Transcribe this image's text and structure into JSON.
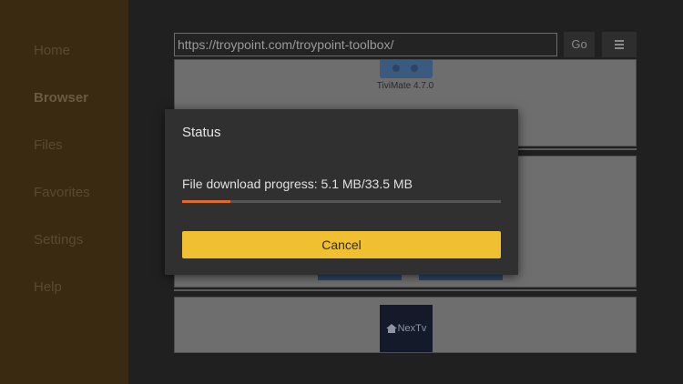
{
  "sidebar": {
    "items": [
      {
        "label": "Home",
        "active": false
      },
      {
        "label": "Browser",
        "active": true
      },
      {
        "label": "Files",
        "active": false
      },
      {
        "label": "Favorites",
        "active": false
      },
      {
        "label": "Settings",
        "active": false
      },
      {
        "label": "Help",
        "active": false
      }
    ]
  },
  "browser": {
    "url": "https://troypoint.com/troypoint-toolbox/",
    "go_label": "Go",
    "cards": {
      "tivimate_label": "TiviMate 4.7.0",
      "nextv_label": "NexTv"
    }
  },
  "dialog": {
    "title": "Status",
    "progress_text": "File download progress: 5.1 MB/33.5 MB",
    "progress_fraction": 0.152,
    "cancel_label": "Cancel"
  },
  "colors": {
    "accent": "#f0c030",
    "progress": "#e06a2a",
    "sidebar": "#3a2a12"
  }
}
